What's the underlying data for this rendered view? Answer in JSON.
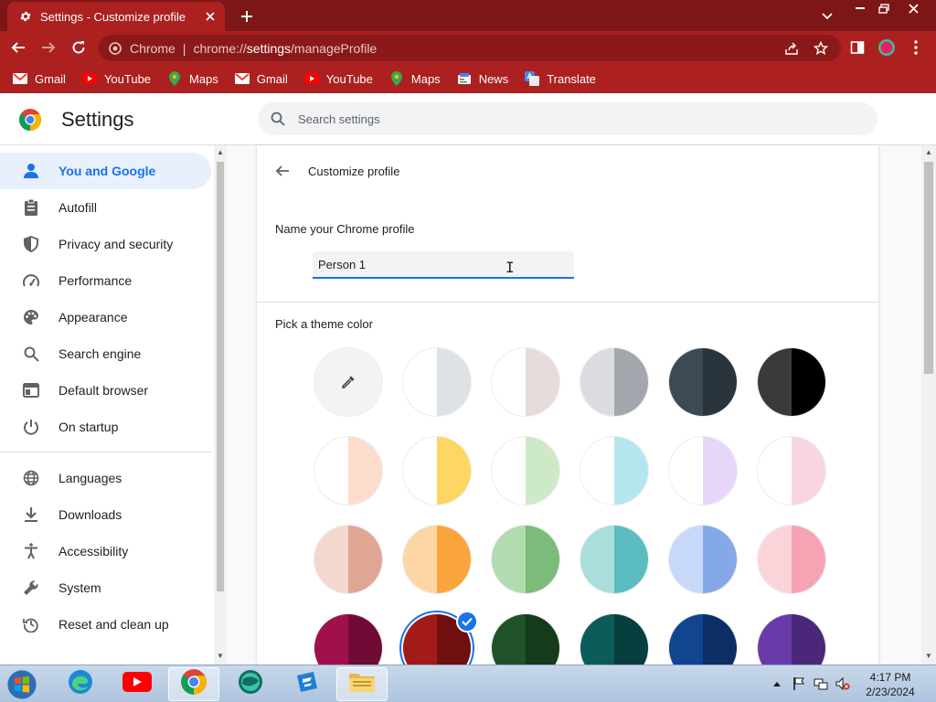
{
  "window": {
    "tab_title": "Settings - Customize profile",
    "minimize": "–",
    "restore": "❐",
    "close": "✕"
  },
  "toolbar": {
    "origin_label": "Chrome",
    "url_scheme": "chrome://",
    "url_host": "settings",
    "url_path": "/manageProfile"
  },
  "bookmarks": [
    {
      "label": "Gmail",
      "icon": "gmail-icon"
    },
    {
      "label": "YouTube",
      "icon": "youtube-icon"
    },
    {
      "label": "Maps",
      "icon": "maps-icon"
    },
    {
      "label": "Gmail",
      "icon": "gmail-icon"
    },
    {
      "label": "YouTube",
      "icon": "youtube-icon"
    },
    {
      "label": "Maps",
      "icon": "maps-icon"
    },
    {
      "label": "News",
      "icon": "news-icon"
    },
    {
      "label": "Translate",
      "icon": "translate-icon"
    }
  ],
  "header": {
    "title": "Settings",
    "search_placeholder": "Search settings"
  },
  "sidebar": {
    "items": [
      {
        "label": "You and Google",
        "icon": "person-icon",
        "active": true
      },
      {
        "label": "Autofill",
        "icon": "clipboard-icon"
      },
      {
        "label": "Privacy and security",
        "icon": "shield-icon"
      },
      {
        "label": "Performance",
        "icon": "speedometer-icon"
      },
      {
        "label": "Appearance",
        "icon": "palette-icon"
      },
      {
        "label": "Search engine",
        "icon": "search-icon"
      },
      {
        "label": "Default browser",
        "icon": "browser-icon"
      },
      {
        "label": "On startup",
        "icon": "power-icon"
      },
      {
        "label": "Languages",
        "icon": "globe-icon"
      },
      {
        "label": "Downloads",
        "icon": "download-icon"
      },
      {
        "label": "Accessibility",
        "icon": "accessibility-icon"
      },
      {
        "label": "System",
        "icon": "wrench-icon"
      },
      {
        "label": "Reset and clean up",
        "icon": "history-icon"
      }
    ]
  },
  "main": {
    "page_title": "Customize profile",
    "name_label": "Name your Chrome profile",
    "name_value": "Person 1",
    "theme_label": "Pick a theme color",
    "swatch_rows": [
      [
        {
          "left": "#f1f3f4",
          "right": "#f1f3f4",
          "custom": true
        },
        {
          "left": "#ffffff",
          "right": "#dee1e6"
        },
        {
          "left": "#ffffff",
          "right": "#e6dcdb"
        },
        {
          "left": "#dadce0",
          "right": "#a3a6ad"
        },
        {
          "left": "#3c4a55",
          "right": "#2a343c"
        },
        {
          "left": "#3a3a3a",
          "right": "#000000"
        }
      ],
      [
        {
          "left": "#ffffff",
          "right": "#fcdcca"
        },
        {
          "left": "#ffffff",
          "right": "#fdd663"
        },
        {
          "left": "#ffffff",
          "right": "#cde9c5"
        },
        {
          "left": "#ffffff",
          "right": "#b3e6ef"
        },
        {
          "left": "#ffffff",
          "right": "#e6d6fa"
        },
        {
          "left": "#ffffff",
          "right": "#f8d6e0"
        }
      ],
      [
        {
          "left": "#f3d8cf",
          "right": "#e0a694"
        },
        {
          "left": "#fdd6a6",
          "right": "#f9a53c"
        },
        {
          "left": "#b3dbb0",
          "right": "#7cbb7a"
        },
        {
          "left": "#a9dedd",
          "right": "#5bbdc1"
        },
        {
          "left": "#c8d8f8",
          "right": "#84a8e8"
        },
        {
          "left": "#fbd4da",
          "right": "#f6a4b3"
        }
      ],
      [
        {
          "left": "#a0104a",
          "right": "#700b36"
        },
        {
          "left": "#a31a1a",
          "right": "#700f0f",
          "selected": true
        },
        {
          "left": "#1f5228",
          "right": "#153a1c"
        },
        {
          "left": "#0b5b59",
          "right": "#063f3d"
        },
        {
          "left": "#11458f",
          "right": "#0b2f66"
        },
        {
          "left": "#6a3aa8",
          "right": "#4a2778"
        }
      ]
    ]
  },
  "taskbar": {
    "apps": [
      {
        "name": "edge-app",
        "icon": "edge-icon"
      },
      {
        "name": "youtube-app",
        "icon": "youtube-icon"
      },
      {
        "name": "chrome-app",
        "icon": "chrome-icon",
        "active": true
      },
      {
        "name": "green-app",
        "icon": "globe-green-icon"
      },
      {
        "name": "blue-app",
        "icon": "blue-app-icon"
      },
      {
        "name": "explorer-app",
        "icon": "folder-icon"
      }
    ],
    "time": "4:17 PM",
    "date": "2/23/2024"
  },
  "colors": {
    "chrome_frame": "#7d1616",
    "chrome_toolbar": "#ac2020",
    "accent": "#1a73e8"
  }
}
